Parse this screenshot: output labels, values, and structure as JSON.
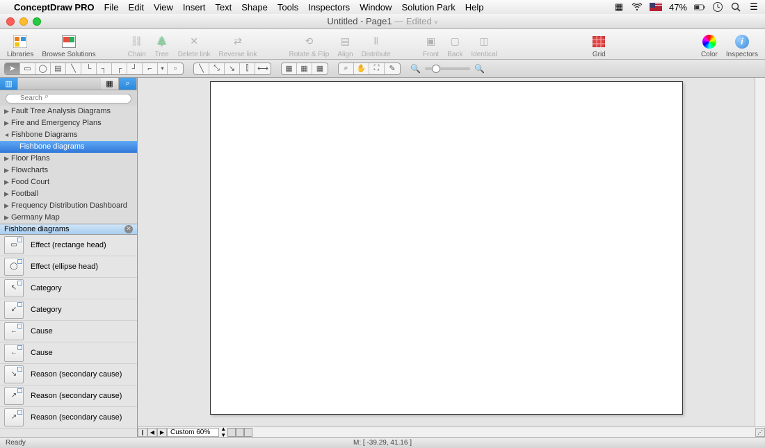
{
  "menubar": {
    "app": "ConceptDraw PRO",
    "items": [
      "File",
      "Edit",
      "View",
      "Insert",
      "Text",
      "Shape",
      "Tools",
      "Inspectors",
      "Window",
      "Solution Park",
      "Help"
    ],
    "battery": "47%"
  },
  "titlebar": {
    "title": "Untitled - Page1",
    "edited": "— Edited"
  },
  "toolbar": {
    "libraries": "Libraries",
    "browse": "Browse Solutions",
    "chain": "Chain",
    "tree": "Tree",
    "delete_link": "Delete link",
    "reverse_link": "Reverse link",
    "rotate_flip": "Rotate & Flip",
    "align": "Align",
    "distribute": "Distribute",
    "front": "Front",
    "back": "Back",
    "identical": "Identical",
    "grid": "Grid",
    "color": "Color",
    "inspectors": "Inspectors"
  },
  "sidebar": {
    "search_placeholder": "Search",
    "tree_items": [
      {
        "label": "Fault Tree Analysis Diagrams",
        "arrow": "▶"
      },
      {
        "label": "Fire and Emergency Plans",
        "arrow": "▶"
      },
      {
        "label": "Fishbone Diagrams",
        "arrow": "▼",
        "expanded": true
      },
      {
        "label": "Fishbone diagrams",
        "child": true,
        "selected": true
      },
      {
        "label": "Floor Plans",
        "arrow": "▶"
      },
      {
        "label": "Flowcharts",
        "arrow": "▶"
      },
      {
        "label": "Food Court",
        "arrow": "▶"
      },
      {
        "label": "Football",
        "arrow": "▶"
      },
      {
        "label": "Frequency Distribution Dashboard",
        "arrow": "▶"
      },
      {
        "label": "Germany Map",
        "arrow": "▶"
      }
    ],
    "shapes_header": "Fishbone diagrams",
    "shapes": [
      {
        "label": "Effect (rectange head)",
        "glyph": "▭"
      },
      {
        "label": "Effect (ellipse head)",
        "glyph": "◯"
      },
      {
        "label": "Category",
        "glyph": "↖"
      },
      {
        "label": "Category",
        "glyph": "↙"
      },
      {
        "label": "Cause",
        "glyph": "←"
      },
      {
        "label": "Cause",
        "glyph": "←"
      },
      {
        "label": "Reason (secondary cause)",
        "glyph": "↘"
      },
      {
        "label": "Reason (secondary cause)",
        "glyph": "↗"
      },
      {
        "label": "Reason (secondary cause)",
        "glyph": "↗"
      }
    ]
  },
  "hscroll": {
    "zoom_label": "Custom 60%"
  },
  "statusbar": {
    "ready": "Ready",
    "coords": "M: [ -39.29, 41.16 ]"
  }
}
